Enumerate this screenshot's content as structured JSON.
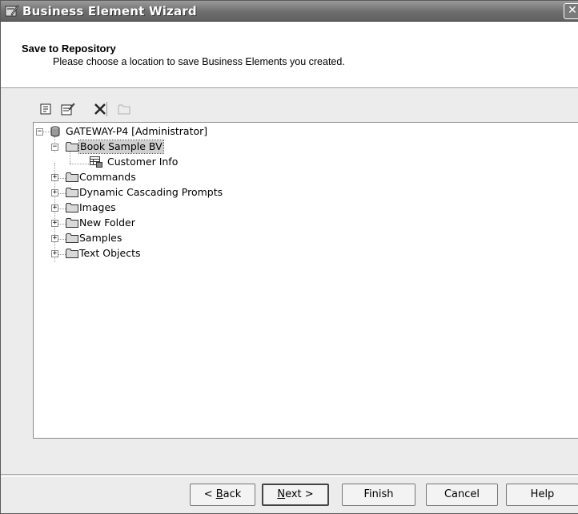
{
  "window": {
    "title": "Business Element Wizard",
    "close_glyph": "✕"
  },
  "header": {
    "title": "Save to Repository",
    "subtitle": "Please choose a location to save Business Elements you created."
  },
  "toolbar": {
    "icons": [
      "properties-icon",
      "edit-properties-icon",
      "delete-icon",
      "new-folder-icon"
    ]
  },
  "tree": {
    "root": {
      "label": "GATEWAY-P4 [Administrator]",
      "expander": "−"
    },
    "selected_folder": {
      "label": "Book Sample BV",
      "expander": "−"
    },
    "child": {
      "label": "Customer Info"
    },
    "folders": [
      {
        "label": "Commands",
        "expander": "+"
      },
      {
        "label": "Dynamic Cascading Prompts",
        "expander": "+"
      },
      {
        "label": "Images",
        "expander": "+"
      },
      {
        "label": "New Folder",
        "expander": "+"
      },
      {
        "label": "Samples",
        "expander": "+"
      },
      {
        "label": "Text Objects",
        "expander": "+"
      }
    ]
  },
  "buttons": {
    "back_prefix": "< ",
    "back_mnemonic": "B",
    "back_rest": "ack",
    "next_mnemonic": "N",
    "next_rest": "ext >",
    "finish": "Finish",
    "cancel": "Cancel",
    "help": "Help"
  }
}
